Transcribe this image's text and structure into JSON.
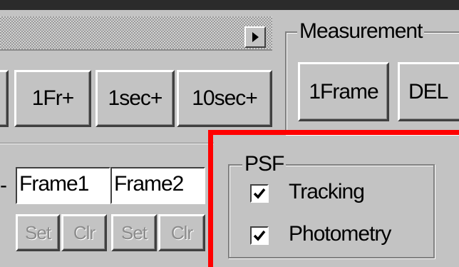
{
  "scroll": {
    "right_arrow_icon": "triangle-right-icon"
  },
  "seek_buttons": [
    {
      "label": "1Fr+"
    },
    {
      "label": "1sec+"
    },
    {
      "label": "10sec+"
    }
  ],
  "measurement": {
    "title": "Measurement",
    "buttons": [
      {
        "label": "1Frame"
      },
      {
        "label": "DEL"
      }
    ]
  },
  "frames": {
    "prefix": "-",
    "fields": [
      {
        "value": "Frame1"
      },
      {
        "value": "Frame2"
      }
    ],
    "buttons": [
      {
        "label": "Set"
      },
      {
        "label": "Clr"
      },
      {
        "label": "Set"
      },
      {
        "label": "Clr"
      }
    ]
  },
  "psf": {
    "title": "PSF",
    "options": [
      {
        "label": "Tracking",
        "checked": true
      },
      {
        "label": "Photometry",
        "checked": true
      }
    ]
  },
  "highlight_color": "#ff0000"
}
